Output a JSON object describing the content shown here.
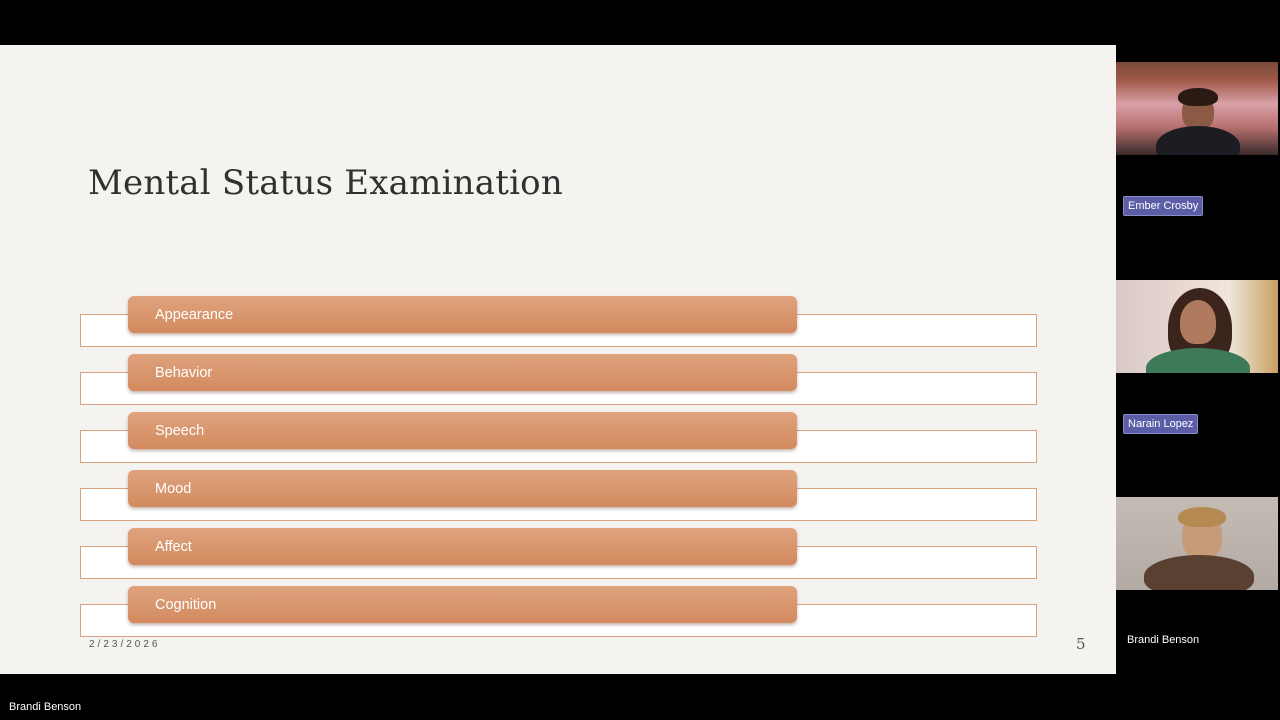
{
  "slide": {
    "title": "Mental Status Examination",
    "items": [
      "Appearance",
      "Behavior",
      "Speech",
      "Mood",
      "Affect",
      "Cognition"
    ],
    "date": "2/23/2026",
    "page_number": "5"
  },
  "participants": [
    {
      "name": "Ember Crosby",
      "label_style": "highlighted"
    },
    {
      "name": "Narain Lopez",
      "label_style": "highlighted"
    },
    {
      "name": "Brandi Benson",
      "label_style": "plain"
    }
  ],
  "presenter_name": "Brandi Benson",
  "colors": {
    "slide_bg": "#f5f3ef",
    "pill": "#d99670",
    "outline": "#d9a27b",
    "name_tag": "#5b5ea6",
    "meeting_bg": "#000000"
  }
}
